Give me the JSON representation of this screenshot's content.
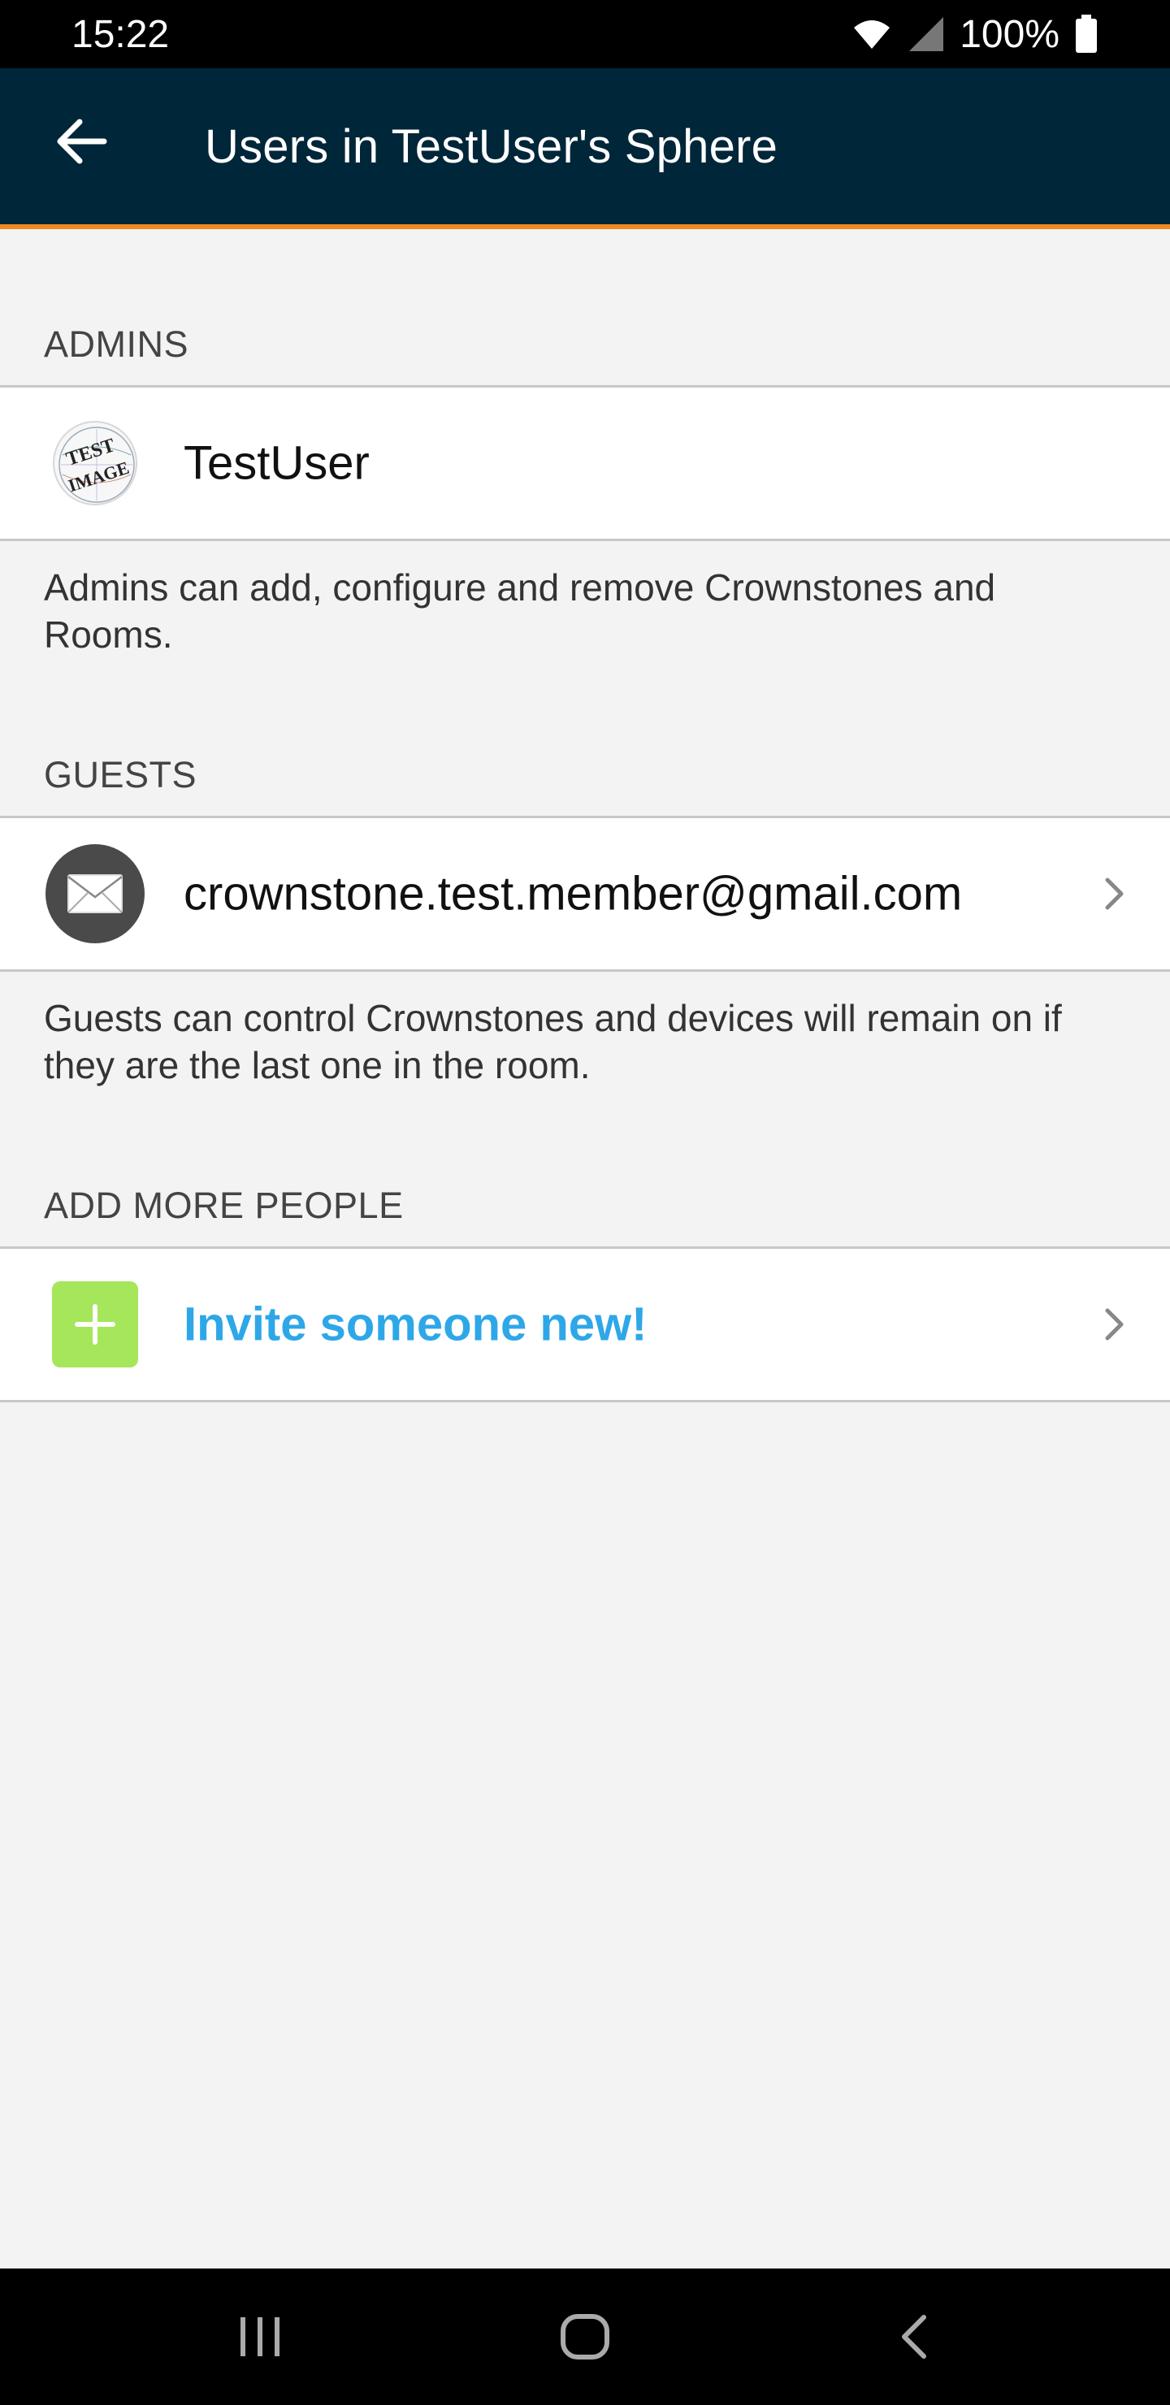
{
  "status_bar": {
    "time": "15:22",
    "battery_text": "100%",
    "icons": [
      "wifi-icon",
      "cell-signal-icon",
      "battery-icon"
    ]
  },
  "app_bar": {
    "title": "Users in TestUser's Sphere",
    "back_icon": "arrow-left-icon",
    "background_color": "#00263a",
    "accent_color": "#f08a1f"
  },
  "sections": {
    "admins": {
      "header": "ADMINS",
      "user": {
        "name": "TestUser",
        "avatar": "test-image-avatar",
        "avatar_text_line1": "TEST",
        "avatar_text_line2": "IMAGE"
      },
      "description": "Admins can add, configure and remove Crownstones and Rooms."
    },
    "guests": {
      "header": "GUESTS",
      "user": {
        "email": "crownstone.test.member@gmail.com",
        "avatar": "mail-icon"
      },
      "description": "Guests can control Crownstones and devices will remain on if they are the last one in the room."
    },
    "add_more": {
      "header": "ADD MORE PEOPLE",
      "invite_label": "Invite someone new!",
      "invite_icon": "plus-icon",
      "invite_color": "#2ea7e8",
      "plus_bg_color": "#a6e65a"
    }
  },
  "nav_bar": {
    "buttons": [
      "recent-apps-icon",
      "home-icon",
      "back-nav-icon"
    ]
  }
}
